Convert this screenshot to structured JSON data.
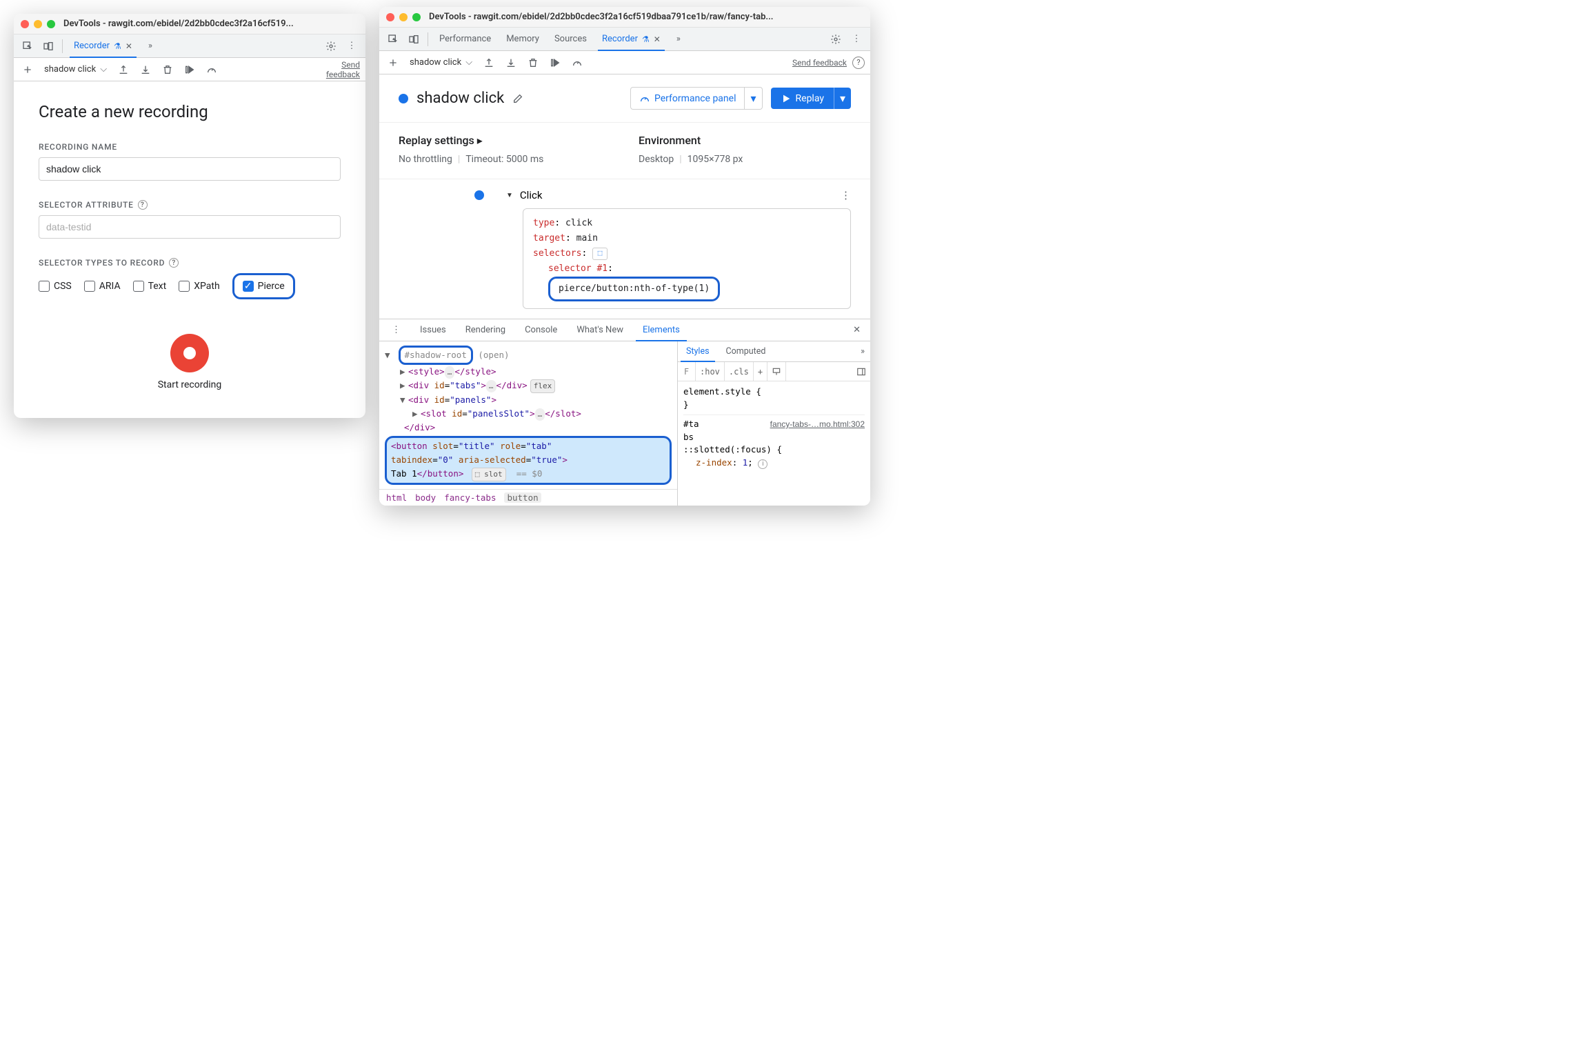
{
  "left": {
    "title": "DevTools - rawgit.com/ebidel/2d2bb0cdec3f2a16cf519...",
    "tabs": {
      "recorder": "Recorder"
    },
    "toolbar": {
      "recording_name": "shadow click",
      "feedback": "Send feedback"
    },
    "form": {
      "heading": "Create a new recording",
      "name_label": "RECORDING NAME",
      "name_value": "shadow click",
      "attr_label": "SELECTOR ATTRIBUTE",
      "attr_placeholder": "data-testid",
      "types_label": "SELECTOR TYPES TO RECORD",
      "types": {
        "css": "CSS",
        "aria": "ARIA",
        "text": "Text",
        "xpath": "XPath",
        "pierce": "Pierce"
      },
      "start": "Start recording"
    }
  },
  "right": {
    "title": "DevTools - rawgit.com/ebidel/2d2bb0cdec3f2a16cf519dbaa791ce1b/raw/fancy-tab...",
    "tabs": {
      "performance": "Performance",
      "memory": "Memory",
      "sources": "Sources",
      "recorder": "Recorder"
    },
    "toolbar": {
      "recording_name": "shadow click",
      "feedback": "Send feedback"
    },
    "header": {
      "title": "shadow click",
      "perf_btn": "Performance panel",
      "replay_btn": "Replay"
    },
    "settings": {
      "replay_label": "Replay settings",
      "throttling": "No throttling",
      "timeout": "Timeout: 5000 ms",
      "env_label": "Environment",
      "device": "Desktop",
      "viewport": "1095×778 px"
    },
    "step": {
      "name": "Click",
      "type_k": "type",
      "type_v": "click",
      "target_k": "target",
      "target_v": "main",
      "selectors_k": "selectors",
      "sel1_k": "selector #1",
      "sel1_v": "pierce/button:nth-of-type(1)"
    },
    "drawer": {
      "tabs": {
        "issues": "Issues",
        "rendering": "Rendering",
        "console": "Console",
        "whatsnew": "What's New",
        "elements": "Elements"
      },
      "tree": {
        "shadow_root": "#shadow-root",
        "shadow_open": "(open)",
        "style_open": "<style>",
        "style_close": "</style>",
        "tabs_open": "<div id=\"tabs\">",
        "div_close": "</div>",
        "flex": "flex",
        "panels_open": "<div id=\"panels\">",
        "slot_open": "<slot id=\"panelsSlot\">",
        "slot_close": "</slot>",
        "button_l1": "<button slot=\"title\" role=\"tab\"",
        "button_l2": "tabindex=\"0\" aria-selected=\"true\">",
        "button_l3a": "Tab 1",
        "button_l3b": "</button>",
        "slot_badge": "slot",
        "eq0": "== $0"
      },
      "crumbs": {
        "html": "html",
        "body": "body",
        "fancy": "fancy-tabs",
        "button": "button"
      },
      "styles": {
        "tabs": {
          "styles": "Styles",
          "computed": "Computed"
        },
        "filter": "F",
        "hov": ":hov",
        "cls": ".cls",
        "rule1": "element.style {",
        "brace": "}",
        "sel2a": "#ta",
        "sel2b": "bs",
        "src2": "fancy-tabs-…mo.html:302",
        "sel3": "::slotted(:focus) {",
        "prop3k": "z-index",
        "prop3v": "1"
      }
    }
  }
}
